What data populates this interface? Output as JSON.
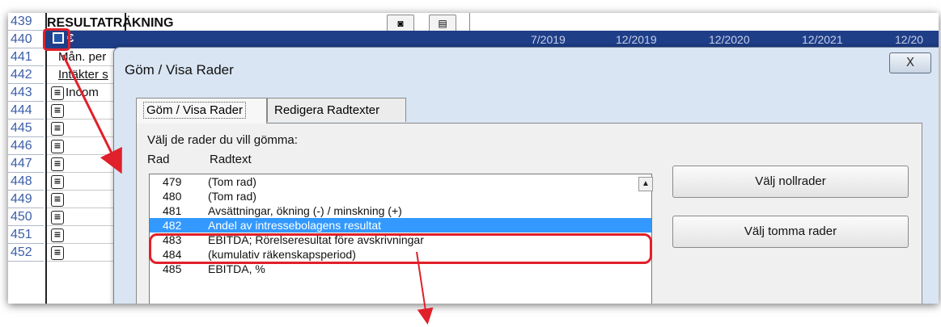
{
  "spreadsheet": {
    "row_numbers": [
      "439",
      "440",
      "441",
      "442",
      "443",
      "444",
      "445",
      "446",
      "447",
      "448",
      "449",
      "450",
      "451",
      "452"
    ],
    "title": "RESULTATRÄKNING",
    "currency_symbol": "€",
    "cells": {
      "r441": "Mån. per",
      "r442": "Intäkter s",
      "r443": "Incom"
    },
    "column_headers": [
      "7/2019",
      "12/2019",
      "12/2020",
      "12/2021",
      "12/20"
    ]
  },
  "dialog": {
    "title": "Göm / Visa Rader",
    "close_label": "X",
    "tabs": [
      "Göm / Visa Rader",
      "Redigera Radtexter"
    ],
    "instruction": "Välj de rader du vill gömma:",
    "col_rad": "Rad",
    "col_radtext": "Radtext",
    "rows": [
      {
        "num": "479",
        "text": "(Tom rad)"
      },
      {
        "num": "480",
        "text": "(Tom rad)"
      },
      {
        "num": "481",
        "text": "Avsättningar, ökning (-) / minskning (+)"
      },
      {
        "num": "482",
        "text": "Andel av intressebolagens resultat"
      },
      {
        "num": "483",
        "text": "EBITDA; Rörelseresultat före avskrivningar"
      },
      {
        "num": "484",
        "text": "(kumulativ räkenskapsperiod)"
      },
      {
        "num": "485",
        "text": "EBITDA, %"
      }
    ],
    "selected_row": "482",
    "buttons": {
      "select_zero": "Välj nollrader",
      "select_empty": "Välj tomma rader"
    }
  },
  "colors": {
    "accent": "#1f3e88",
    "highlight": "#e0202a",
    "selection": "#3399ff"
  }
}
